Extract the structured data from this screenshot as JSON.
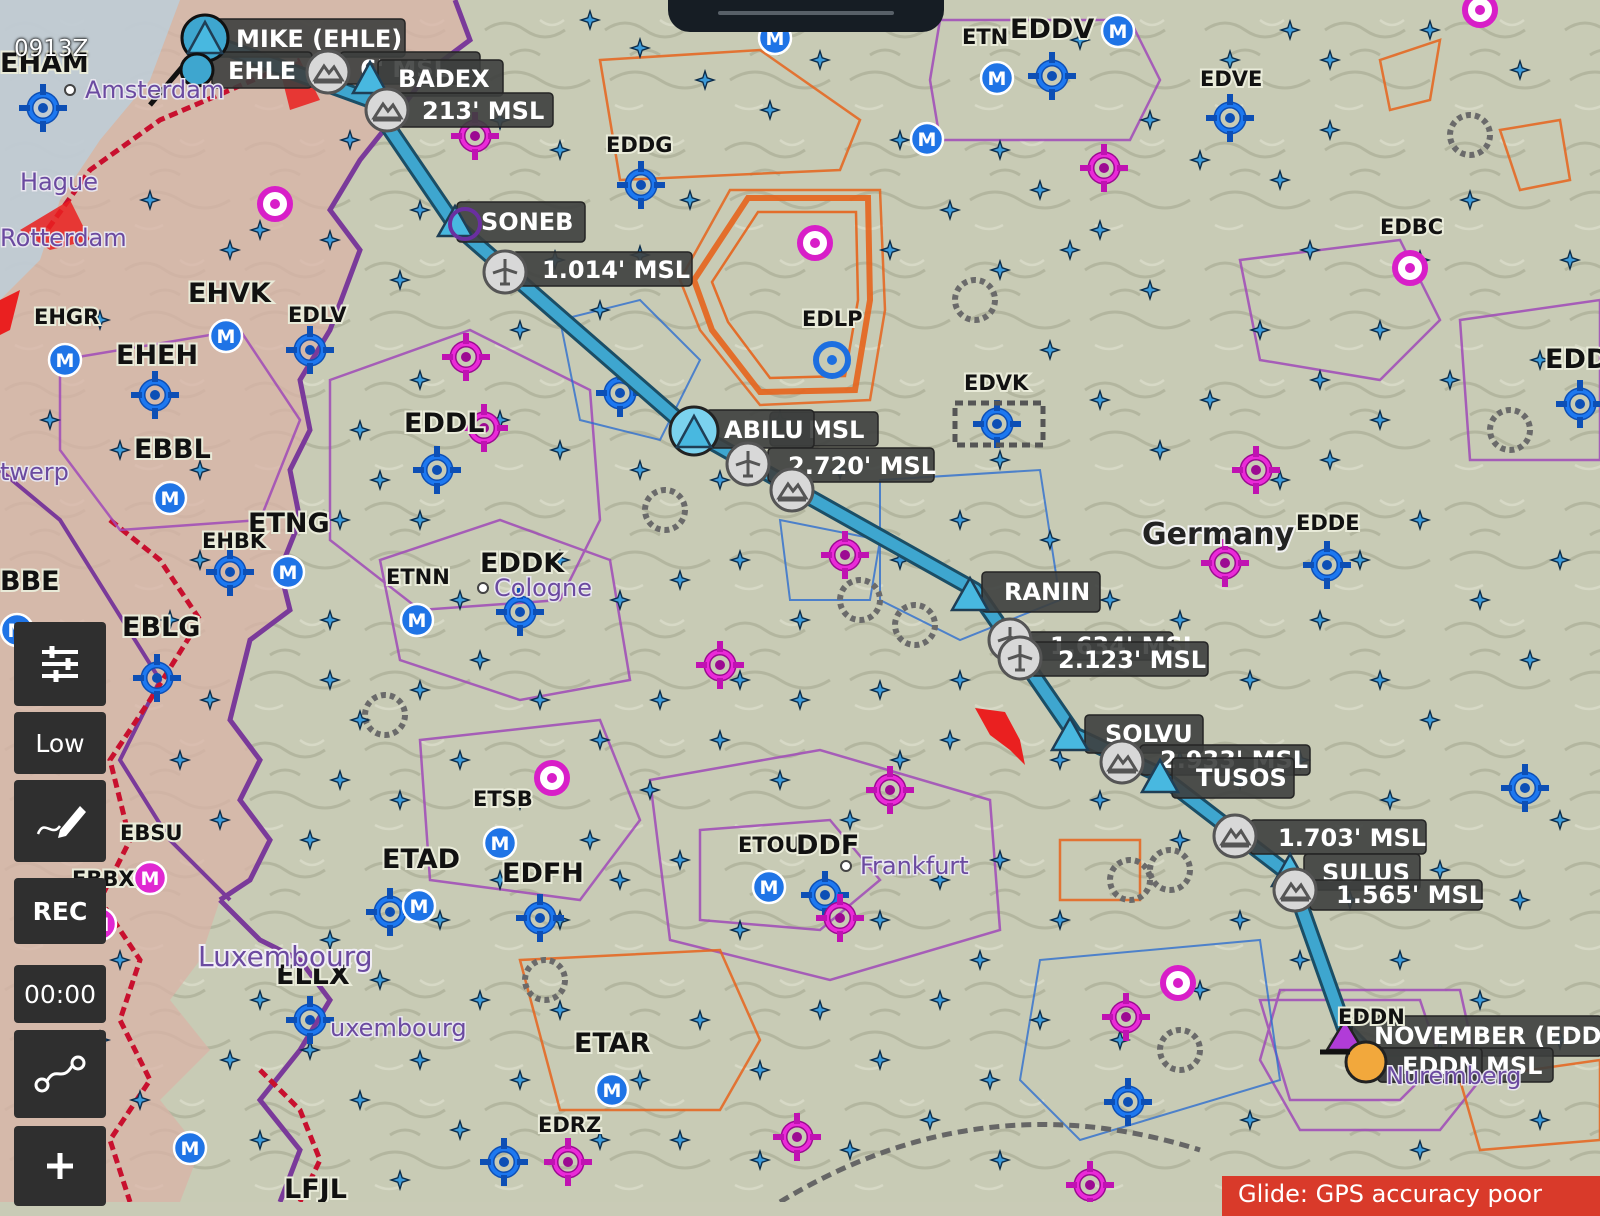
{
  "header": {
    "utc_time": "0913Z"
  },
  "airports": [
    {
      "id": "EHAM",
      "label": "EHAM"
    },
    {
      "id": "EHVK",
      "label": "EHVK"
    },
    {
      "id": "EHGR",
      "label": "EHGR"
    },
    {
      "id": "EHEH",
      "label": "EHEH"
    },
    {
      "id": "EBBL",
      "label": "EBBL"
    },
    {
      "id": "EHBK",
      "label": "EHBK"
    },
    {
      "id": "ETNG",
      "label": "ETNG"
    },
    {
      "id": "EBBE",
      "label": "BBE"
    },
    {
      "id": "EBLG",
      "label": "EBLG"
    },
    {
      "id": "EBSU",
      "label": "EBSU"
    },
    {
      "id": "EBBX",
      "label": "EBBX"
    },
    {
      "id": "EDLV",
      "label": "EDLV"
    },
    {
      "id": "EDDL",
      "label": "EDDL"
    },
    {
      "id": "ETNN",
      "label": "ETNN"
    },
    {
      "id": "EDDK",
      "label": "EDDK"
    },
    {
      "id": "ETSB",
      "label": "ETSB"
    },
    {
      "id": "ETAD",
      "label": "ETAD"
    },
    {
      "id": "EDFH",
      "label": "EDFH"
    },
    {
      "id": "ELLX",
      "label": "ELLX"
    },
    {
      "id": "ETAR",
      "label": "ETAR"
    },
    {
      "id": "EDRZ",
      "label": "EDRZ"
    },
    {
      "id": "LFJL",
      "label": "LFJL"
    },
    {
      "id": "EDDG",
      "label": "EDDG"
    },
    {
      "id": "EDLP",
      "label": "EDLP"
    },
    {
      "id": "EDVK",
      "label": "EDVK"
    },
    {
      "id": "ETOU",
      "label": "ETOU"
    },
    {
      "id": "EDDF",
      "label": "DDF"
    },
    {
      "id": "ETNT",
      "label": "ETN"
    },
    {
      "id": "EDDV",
      "label": "EDDV"
    },
    {
      "id": "EDVE",
      "label": "EDVE"
    },
    {
      "id": "EDBC",
      "label": "EDBC"
    },
    {
      "id": "EDDE",
      "label": "EDDE"
    },
    {
      "id": "EDDP",
      "label": "EDD"
    },
    {
      "id": "EDDN",
      "label": "EDDN"
    }
  ],
  "cities": [
    {
      "id": "amsterdam",
      "label": "Amsterdam"
    },
    {
      "id": "the-hague",
      "label": "Hague"
    },
    {
      "id": "rotterdam",
      "label": "Rotterdam"
    },
    {
      "id": "antwerp",
      "label": "twerp"
    },
    {
      "id": "cologne",
      "label": "Cologne"
    },
    {
      "id": "frankfurt",
      "label": "Frankfurt"
    },
    {
      "id": "luxembourg",
      "label": "Luxembourg"
    },
    {
      "id": "luxembourg-city",
      "label": "uxembourg"
    },
    {
      "id": "nuremberg",
      "label": "Nuremberg"
    }
  ],
  "country_label": "Germany",
  "route": {
    "waypoints": [
      {
        "id": "mike",
        "label": "MIKE (EHLE)"
      },
      {
        "id": "ehle",
        "label": "EHLE"
      },
      {
        "id": "badex",
        "label": "BADEX"
      },
      {
        "id": "soneb",
        "label": "SONEB"
      },
      {
        "id": "abilu",
        "label": "ABILU"
      },
      {
        "id": "ranin",
        "label": "RANIN"
      },
      {
        "id": "solvu",
        "label": "SOLVU"
      },
      {
        "id": "tusos",
        "label": "TUSOS"
      },
      {
        "id": "sulus",
        "label": "SULUS"
      },
      {
        "id": "november",
        "label": "NOVEMBER (EDDN)"
      },
      {
        "id": "eddn",
        "label": "EDDN"
      }
    ],
    "altitude_tags": [
      {
        "id": "alt-ehle",
        "label": "6' MSL"
      },
      {
        "id": "alt-badex",
        "label": "213' MSL"
      },
      {
        "id": "alt-soneb",
        "label": "1.014' MSL"
      },
      {
        "id": "alt-abilu",
        "label": "MSL"
      },
      {
        "id": "alt-abilu2",
        "label": "2.720' MSL"
      },
      {
        "id": "alt-ranin",
        "label": "1.634' MSL"
      },
      {
        "id": "alt-ranin2",
        "label": "2.123' MSL"
      },
      {
        "id": "alt-solvu",
        "label": "2.933' MSL"
      },
      {
        "id": "alt-tusos",
        "label": "1.703' MSL"
      },
      {
        "id": "alt-sulus",
        "label": "1.565' MSL"
      },
      {
        "id": "alt-eddn",
        "label": "MSL"
      }
    ]
  },
  "toolbar": {
    "layers_icon": "sliders-icon",
    "detail_label": "Low",
    "annotate_icon": "pencil-icon",
    "record_label": "REC",
    "timer": "00:00",
    "route_icon": "route-icon",
    "zoom_in_icon": "plus-icon"
  },
  "banner": {
    "text": "Glide: GPS accuracy poor"
  },
  "colors": {
    "route": "#3ea6cf",
    "restricted": "#e6641c",
    "airspace": "#a35cb5",
    "airport_blue": "#1d6fe0",
    "airport_magenta": "#e020d0",
    "border_red": "#c8102e",
    "banner": "#d93a2a"
  }
}
